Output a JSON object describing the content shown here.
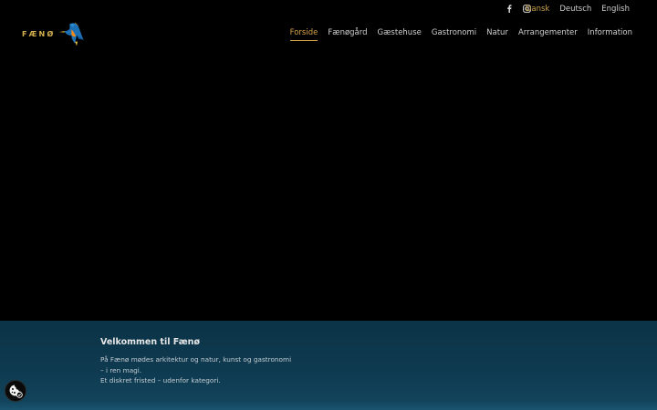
{
  "social": {
    "facebook_icon": "facebook-icon",
    "instagram_icon": "instagram-icon"
  },
  "languages": [
    {
      "label": "Dansk",
      "active": true
    },
    {
      "label": "Deutsch",
      "active": false
    },
    {
      "label": "English",
      "active": false
    }
  ],
  "logo": {
    "text": "FÆNØ",
    "bird_icon": "kingfisher-bird-icon"
  },
  "nav": {
    "items": [
      {
        "label": "Forside",
        "active": true
      },
      {
        "label": "Fænøgård",
        "active": false
      },
      {
        "label": "Gæstehuse",
        "active": false
      },
      {
        "label": "Gastronomi",
        "active": false
      },
      {
        "label": "Natur",
        "active": false
      },
      {
        "label": "Arrangementer",
        "active": false
      },
      {
        "label": "Information",
        "active": false
      }
    ]
  },
  "welcome": {
    "title": "Velkommen til Fænø",
    "lines": [
      "På Fænø mødes arkitektur og natur, kunst og gastronomi",
      "– i ren magi.",
      "Et diskret fristed – udenfor kategori."
    ]
  },
  "cookie": {
    "icon": "cookie-settings-icon"
  },
  "colors": {
    "accent": "#d6a24a",
    "welcome_bg": "#0e3a50",
    "background": "#000000"
  }
}
